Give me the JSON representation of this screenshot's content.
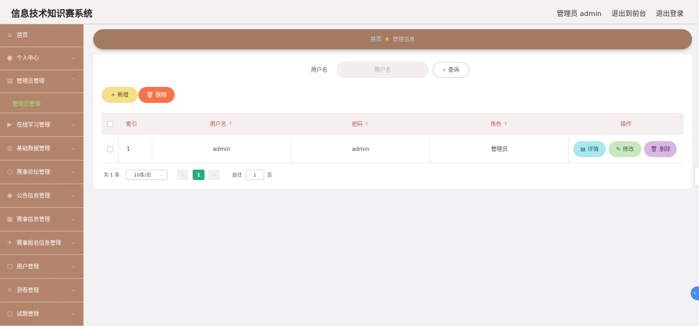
{
  "header": {
    "app_title": "信息技术知识赛系统",
    "user_label": "管理员 admin",
    "to_front_label": "退出到前台",
    "logout_label": "退出登录"
  },
  "sidebar": {
    "items": [
      {
        "label": "首页",
        "icon": "home-icon"
      },
      {
        "label": "个人中心",
        "icon": "user-icon"
      },
      {
        "label": "管理员管理",
        "icon": "admin-icon"
      },
      {
        "label": "在线学习管理",
        "icon": "video-icon"
      },
      {
        "label": "基础数据管理",
        "icon": "data-icon"
      },
      {
        "label": "赛事论坛管理",
        "icon": "forum-icon"
      },
      {
        "label": "公告信息管理",
        "icon": "notice-icon"
      },
      {
        "label": "赛事信息管理",
        "icon": "event-icon"
      },
      {
        "label": "赛事报名信息管理",
        "icon": "signup-icon"
      },
      {
        "label": "用户管理",
        "icon": "users-icon"
      },
      {
        "label": "测卷管理",
        "icon": "paper-icon"
      },
      {
        "label": "试题管理",
        "icon": "question-icon"
      }
    ],
    "active_sub": "管理员管理"
  },
  "breadcrumb": {
    "home": "首页",
    "current": "管理信息"
  },
  "search": {
    "label": "用户名",
    "placeholder": "用户名",
    "value": "",
    "button_label": "查询"
  },
  "toolbar": {
    "add_label": "新增",
    "delete_label": "删除"
  },
  "table": {
    "columns": [
      "索引",
      "用户名",
      "密码",
      "角色",
      "操作"
    ],
    "rows": [
      {
        "index": "1",
        "username": "admin",
        "password": "admin",
        "role": "管理员"
      }
    ],
    "actions": {
      "detail": "详情",
      "edit": "修改",
      "delete": "删除"
    }
  },
  "pagination": {
    "total": "共 1 条",
    "page_size": "10条/页",
    "current_page": "1",
    "goto_label": "前往",
    "goto_value": "1",
    "page_suffix": "页"
  },
  "colors": {
    "sidebar_bg": "#b2836a",
    "breadcrumb_bg": "#a47a62",
    "active_sub": "#a7e27a",
    "add_button": "#f3e089",
    "delete_button": "#f7744a",
    "page_active": "#1fb17a"
  }
}
